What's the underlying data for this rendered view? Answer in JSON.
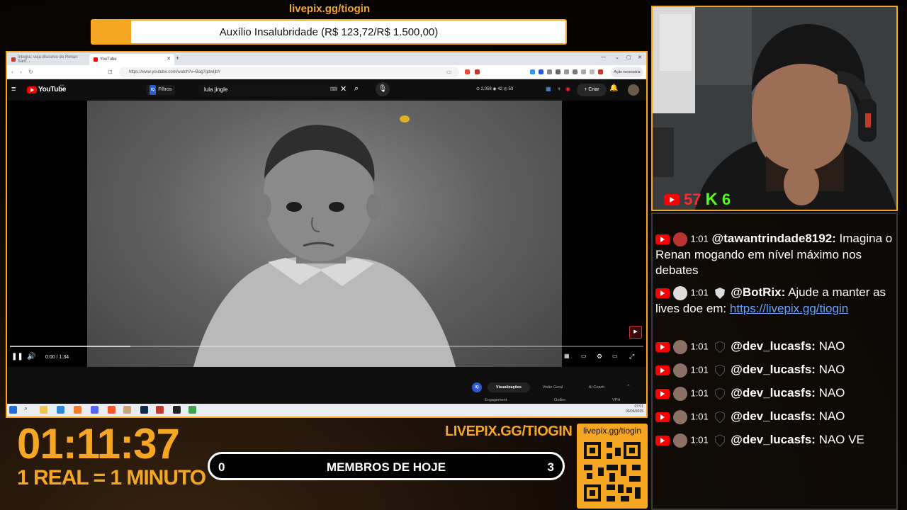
{
  "goal": {
    "url": "livepix.gg/tiogin",
    "text": "Auxílio Insalubridade (R$ 123,72/R$ 1.500,00)",
    "progress": 0.0825
  },
  "browser": {
    "tabs": [
      {
        "label": "Íntegra: veja discurso de Renan Sant..."
      },
      {
        "label": "YouTube"
      }
    ],
    "url": "https://www.youtube.com/watch?v=Bag7gdwIjbY",
    "profile": "Ação necessária"
  },
  "youtube": {
    "brand": "YouTube",
    "region": "BR",
    "filters": "Filtros",
    "filters_badge": "IQ",
    "search_value": "lula jingle",
    "stats": "⊙ 2,058  ◉ 42  ◎ 53",
    "create": "+ Criar",
    "video_time": "0:00 / 1:34",
    "video_progress": 0.0,
    "ext_logo": "IQ",
    "ext_tabs": [
      "Visualizações",
      "Visão Geral",
      "AI Coach"
    ],
    "ext_cols": [
      "Engagement",
      "Outlier",
      "VPH"
    ]
  },
  "taskbar": {
    "clock_time": "07:01",
    "clock_date": "03/06/2025"
  },
  "webcam": {
    "youtube_viewers": "57",
    "kick_letter": "K",
    "kick_viewers": "6"
  },
  "chat": {
    "messages": [
      {
        "time": "1:01",
        "user": "@tawantrindade8192:",
        "text": "Imagina o Renan mogando em nível máximo nos debates"
      },
      {
        "time": "1:01",
        "user": "@BotRix:",
        "text": "Ajude a manter as lives doe em:",
        "link": "https://livepix.gg/tiogin"
      },
      {
        "time": "1:01",
        "user": "@dev_lucasfs:",
        "text": "NAO"
      },
      {
        "time": "1:01",
        "user": "@dev_lucasfs:",
        "text": "NAO"
      },
      {
        "time": "1:01",
        "user": "@dev_lucasfs:",
        "text": "NAO"
      },
      {
        "time": "1:01",
        "user": "@dev_lucasfs:",
        "text": "NAO"
      },
      {
        "time": "1:01",
        "user": "@dev_lucasfs:",
        "text": "NAO VE"
      }
    ]
  },
  "bottom": {
    "timer": "01:11:37",
    "rate": "1 REAL = 1 MINUTO",
    "members_left": "0",
    "members_label": "MEMBROS DE HOJE",
    "members_right": "3",
    "livepix_big": "LIVEPIX.GG/TIOGIN",
    "qr_label": "livepix.gg/tiogin"
  },
  "colors": {
    "accent": "#f5a623",
    "youtube_red": "#ff0000",
    "kick_green": "#53fc18"
  }
}
